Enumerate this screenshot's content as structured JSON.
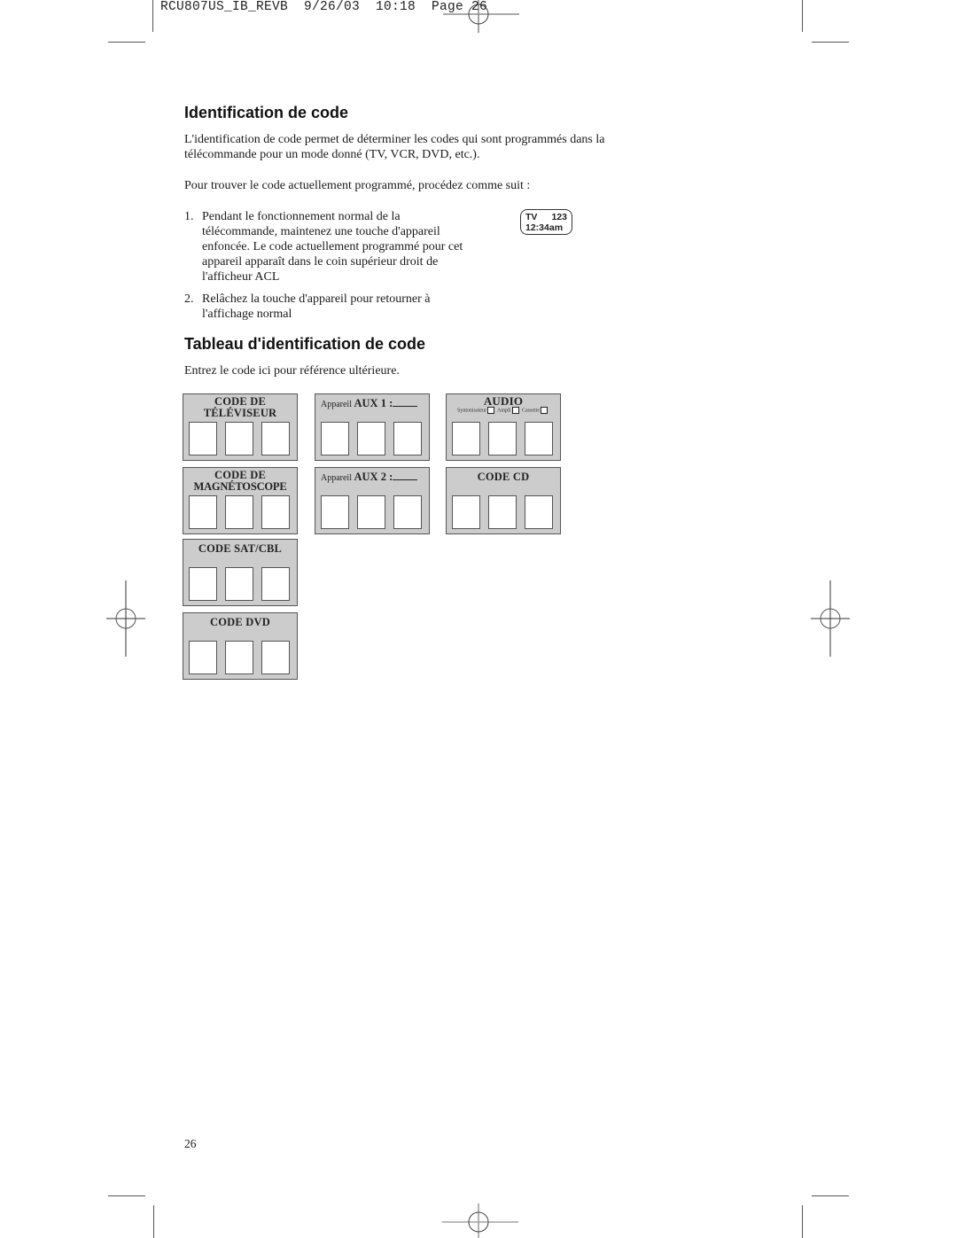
{
  "slug": {
    "text": "RCU807US_IB_REVB  9/26/03  10:18  Page 26"
  },
  "section1": {
    "heading": "Identification de code",
    "intro": "L'identification de code permet de déterminer les codes qui sont programmés dans la télécommande pour un mode donné (TV, VCR, DVD, etc.).",
    "lead": "Pour trouver le code actuellement programmé, procédez comme suit :",
    "steps": [
      {
        "num": "1.",
        "text": "Pendant le fonctionnement normal de la télécommande, maintenez une touche d'appareil enfoncée. Le code actuellement programmé pour cet appareil apparaît dans le coin supérieur droit de l'afficheur ACL"
      },
      {
        "num": "2.",
        "text": "Relâchez la touche d'appareil pour retourner à l'affichage normal"
      }
    ],
    "lcd": {
      "mode": "TV",
      "code": "123",
      "time": "12:34am"
    }
  },
  "section2": {
    "heading": "Tableau d'identification de code",
    "intro": "Entrez le code ici pour référence ultérieure.",
    "cards": {
      "tv": {
        "line1": "CODE DE",
        "line2": "TÉLÉVISEUR"
      },
      "vcr": {
        "line1": "CODE DE",
        "line2": "MAGNÉTOSCOPE"
      },
      "sat": {
        "title": "CODE SAT/CBL"
      },
      "dvd": {
        "title": "CODE DVD"
      },
      "aux1": {
        "prefix": "Appareil",
        "label": "AUX 1 :"
      },
      "aux2": {
        "prefix": "Appareil",
        "label": "AUX 2 :"
      },
      "audio": {
        "title": "AUDIO",
        "options": [
          "Syntonisateur",
          "Ampli",
          "Cassette"
        ]
      },
      "cd": {
        "title": "CODE CD"
      }
    }
  },
  "footer": {
    "page_number": "26"
  }
}
